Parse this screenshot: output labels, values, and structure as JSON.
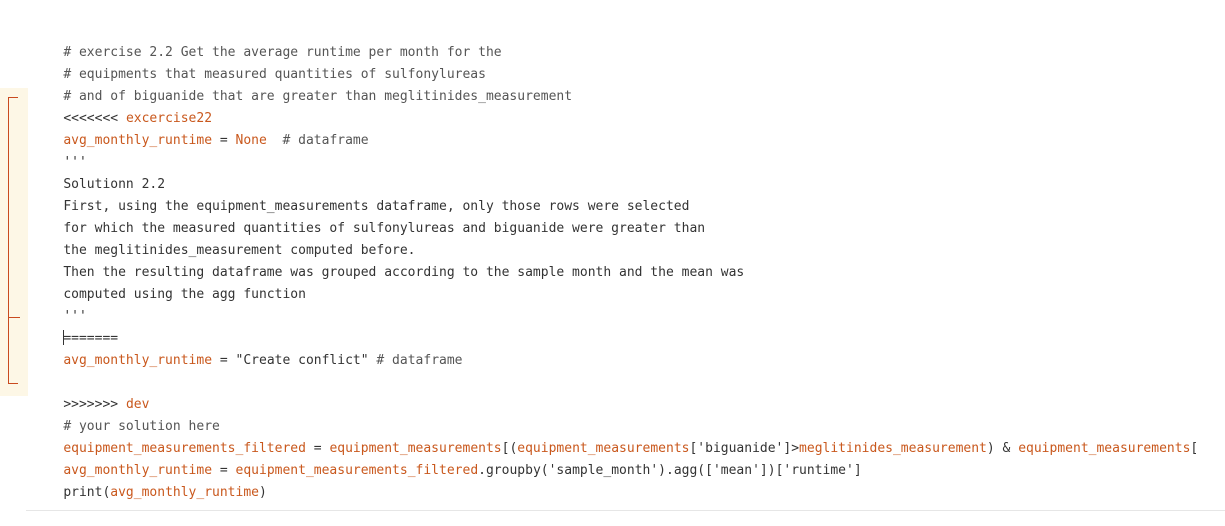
{
  "lines": {
    "l1": "# exercise 2.2 Get the average runtime per month for the",
    "l2": "# equipments that measured quantities of sulfonylureas",
    "l3": "# and of biguanide that are greater than meglitinides_measurement",
    "l4_marker": "<<<<<<<",
    "l4_branch": "excercise22",
    "l5_var": "avg_monthly_runtime",
    "l5_eq": " = ",
    "l5_none": "None",
    "l5_cmt": "  # dataframe",
    "l6": "'''",
    "l7": "Solutionn 2.2",
    "l8": "First, using the equipment_measurements dataframe, only those rows were selected",
    "l9": "for which the measured quantities of sulfonylureas and biguanide were greater than",
    "l10": "the meglitinides_measurement computed before.",
    "l11": "Then the resulting dataframe was grouped according to the sample month and the mean was",
    "l12": "computed using the agg function",
    "l13": "'''",
    "l14": "=======",
    "l15_var": "avg_monthly_runtime",
    "l15_eq": " = ",
    "l15_str": "\"Create conflict\"",
    "l15_cmt": " # dataframe",
    "l17_marker": ">>>>>>>",
    "l17_branch": "dev",
    "l18": "# your solution here",
    "l19_var1": "equipment_measurements_filtered",
    "l19_eq": " = ",
    "l19_var2": "equipment_measurements",
    "l19_p1": "[(",
    "l19_var3": "equipment_measurements",
    "l19_key": "['biguanide']>",
    "l19_var4": "meglitinides_measurement",
    "l19_p2": ") & ",
    "l19_var5": "equipment_measurements",
    "l19_p3": "[",
    "l20_var1": "avg_monthly_runtime",
    "l20_eq": " = ",
    "l20_var2": "equipment_measurements_filtered",
    "l20_rest": ".groupby('sample_month').agg(['mean'])['runtime']",
    "l21_fn": "print(",
    "l21_var": "avg_monthly_runtime",
    "l21_end": ")"
  }
}
